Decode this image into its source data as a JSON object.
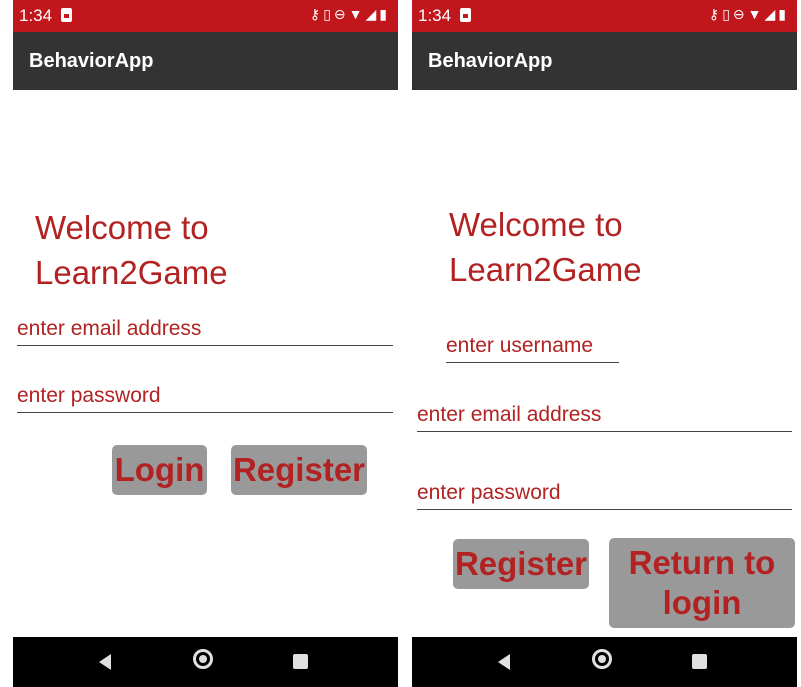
{
  "status_bar": {
    "time": "1:34"
  },
  "app_bar": {
    "title": "BehaviorApp"
  },
  "login_screen": {
    "welcome_line1": "Welcome to",
    "welcome_line2": "Learn2Game",
    "email_placeholder": "enter email address",
    "password_placeholder": "enter password",
    "login_label": "Login",
    "register_label": "Register"
  },
  "register_screen": {
    "welcome_line1": "Welcome to",
    "welcome_line2": "Learn2Game",
    "username_placeholder": "enter username",
    "email_placeholder": "enter email address",
    "password_placeholder": "enter password",
    "register_label": "Register",
    "return_line1": "Return to",
    "return_line2": "login"
  },
  "colors": {
    "status_bar": "#c0161c",
    "app_bar": "#333333",
    "accent_text": "#b22222",
    "button": "#999999"
  },
  "icons": [
    "notification-icon",
    "key-icon",
    "vibrate-icon",
    "do-not-disturb-icon",
    "wifi-icon",
    "signal-icon",
    "battery-icon",
    "back-icon",
    "home-icon",
    "recents-icon"
  ]
}
